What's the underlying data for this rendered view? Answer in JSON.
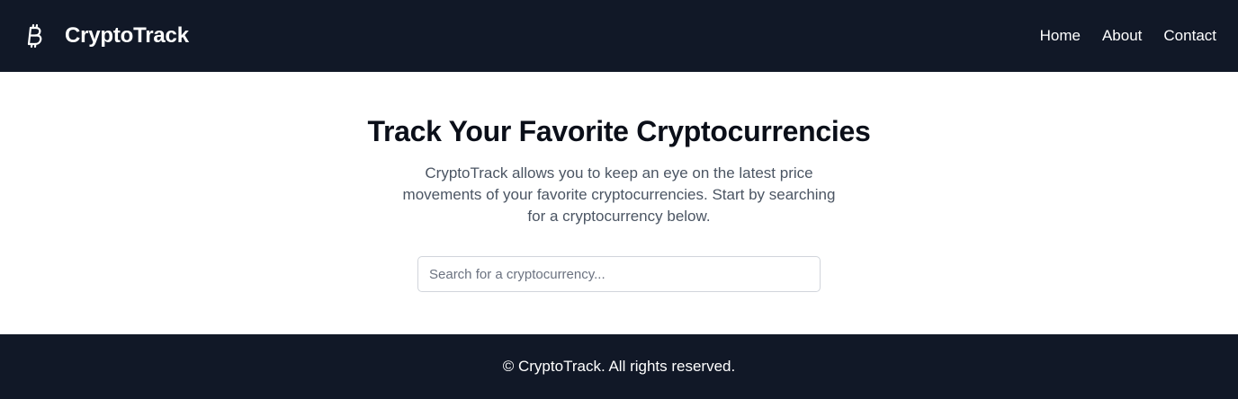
{
  "header": {
    "brand_icon": "bitcoin-icon",
    "brand_name": "CryptoTrack",
    "nav": [
      {
        "label": "Home"
      },
      {
        "label": "About"
      },
      {
        "label": "Contact"
      }
    ]
  },
  "hero": {
    "title": "Track Your Favorite Cryptocurrencies",
    "description": "CryptoTrack allows you to keep an eye on the latest price movements of your favorite cryptocurrencies. Start by searching for a cryptocurrency below."
  },
  "search": {
    "value": "",
    "placeholder": "Search for a cryptocurrency..."
  },
  "footer": {
    "text": "© CryptoTrack. All rights reserved."
  },
  "colors": {
    "header_bg": "#111827",
    "footer_bg": "#111827",
    "body_text": "#4b5563"
  }
}
